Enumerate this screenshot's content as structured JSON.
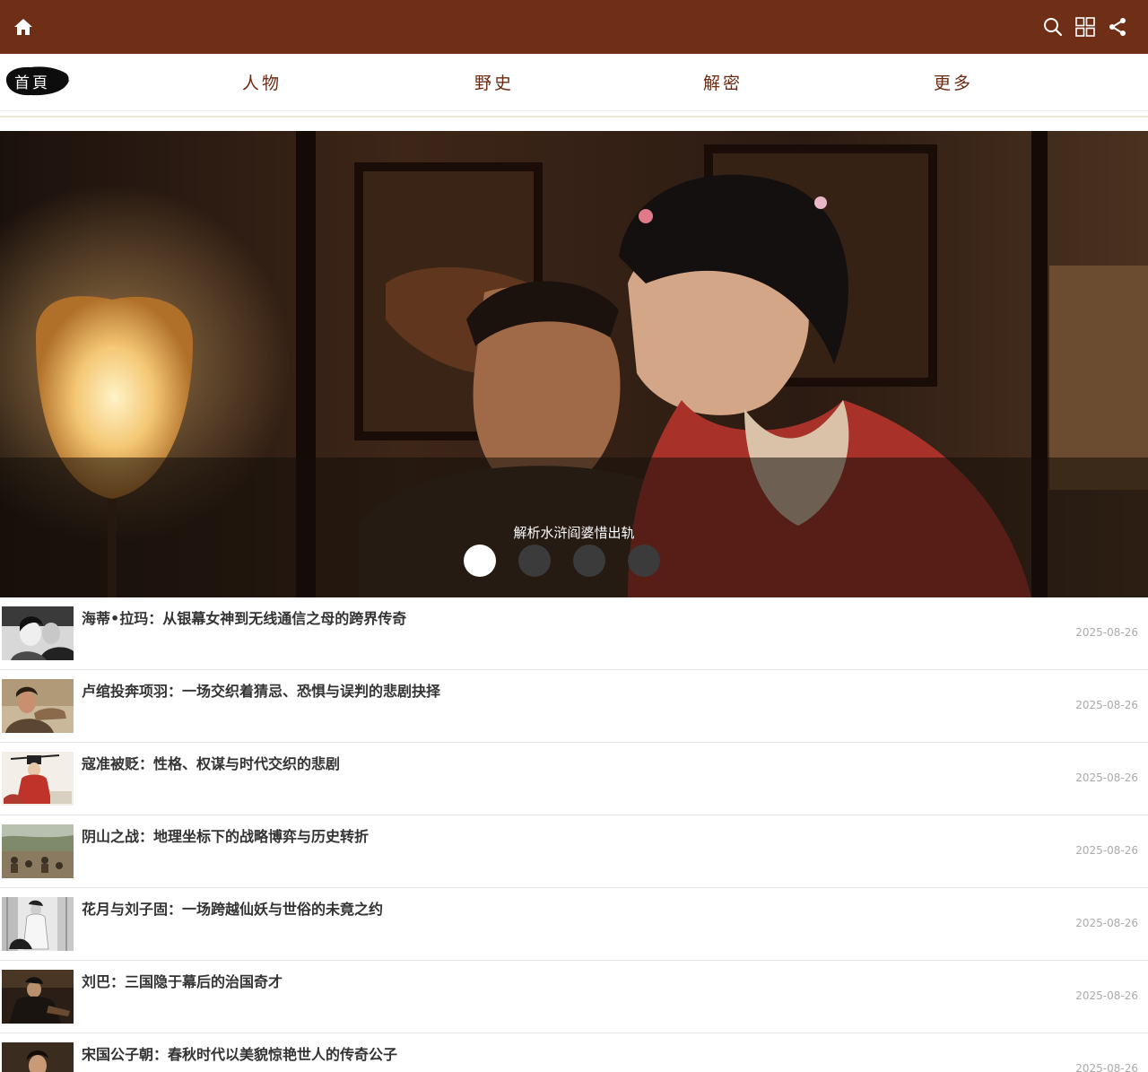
{
  "header": {
    "home_icon": "home-icon",
    "actions": [
      "search-icon",
      "grid-icon",
      "share-icon"
    ],
    "bg_color": "#6f2e16"
  },
  "nav": {
    "home_label": "首頁",
    "items": [
      {
        "label": "人物"
      },
      {
        "label": "野史"
      },
      {
        "label": "解密"
      },
      {
        "label": "更多"
      }
    ],
    "text_color": "#6b2a12"
  },
  "slider": {
    "caption": "解析水浒阎婆惜出轨",
    "total_slides": 4,
    "active_index": 0
  },
  "articles": [
    {
      "title": "海蒂•拉玛：从银幕女神到无线通信之母的跨界传奇",
      "date": "2025-08-26"
    },
    {
      "title": "卢绾投奔项羽：一场交织着猜忌、恐惧与误判的悲剧抉择",
      "date": "2025-08-26"
    },
    {
      "title": "寇准被贬：性格、权谋与时代交织的悲剧",
      "date": "2025-08-26"
    },
    {
      "title": "阴山之战：地理坐标下的战略博弈与历史转折",
      "date": "2025-08-26"
    },
    {
      "title": "花月与刘子固：一场跨越仙妖与世俗的未竟之约",
      "date": "2025-08-26"
    },
    {
      "title": "刘巴：三国隐于幕后的治国奇才",
      "date": "2025-08-26"
    },
    {
      "title": "宋国公子朝：春秋时代以美貌惊艳世人的传奇公子",
      "date": "2025-08-26"
    }
  ]
}
